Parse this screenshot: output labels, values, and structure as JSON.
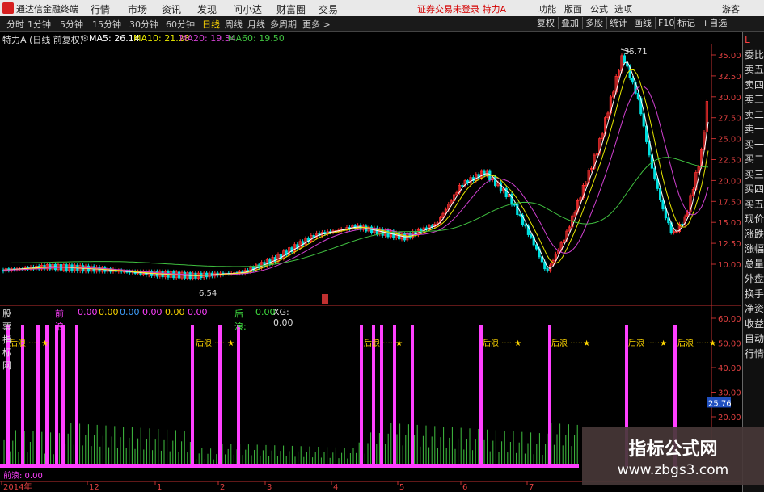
{
  "titlebar": {
    "app_title": "通达信金融终端",
    "menus": [
      "行情",
      "市场",
      "资讯",
      "发现",
      "问小达",
      "财富圈",
      "交易"
    ],
    "notice": "证券交易未登录  特力A",
    "right": [
      "功能",
      "版面",
      "公式",
      "选项"
    ],
    "user": "游客"
  },
  "toolbar": {
    "periods": [
      "分时",
      "1分钟",
      "5分钟",
      "15分钟",
      "30分钟",
      "60分钟",
      "日线",
      "周线",
      "月线",
      "多周期",
      "更多 >"
    ],
    "active": "日线",
    "right_buttons": [
      "复权",
      "叠加",
      "多股",
      "统计",
      "画线",
      "F10",
      "标记",
      "+自选"
    ]
  },
  "info": {
    "stock": "特力A (日线 前复权)",
    "ma5": "MA5: 26.14",
    "ma10": "MA10: 21.28",
    "ma20": "MA20: 19.34",
    "ma60": "MA60: 19.50"
  },
  "price_axis": [
    "35.00",
    "32.50",
    "30.00",
    "27.50",
    "25.00",
    "22.50",
    "20.00",
    "17.50",
    "15.00",
    "12.50",
    "10.00"
  ],
  "price_markers": {
    "high": "35.71",
    "low": "6.54"
  },
  "indicator": {
    "name": "股票指标网",
    "label1": "前浪",
    "values": [
      "0.00",
      "0.00",
      "0.00",
      "0.00",
      "0.00",
      "0.00"
    ],
    "label2": "后浪:",
    "v2": "0.00",
    "xg": "XG: 0.00",
    "axis": [
      "60.00",
      "50.00",
      "40.00",
      "30.00",
      "20.00"
    ],
    "current": "25.76",
    "signal_text": "后浪",
    "bottom_label": "前浪: 0.00"
  },
  "xaxis": [
    "2014年",
    "12",
    "1",
    "2",
    "3",
    "4",
    "5",
    "6",
    "7"
  ],
  "sidebar": [
    "L",
    "委比",
    "卖五",
    "卖四",
    "卖三",
    "卖二",
    "卖一",
    "买一",
    "买二",
    "买三",
    "买四",
    "买五",
    "现价",
    "涨跌",
    "涨幅",
    "总量",
    "外盘",
    "换手",
    "净资",
    "收益",
    "自动",
    "行情"
  ],
  "colors": {
    "up": "#ff3030",
    "down": "#00e0e0",
    "ma5": "#ffffff",
    "ma10": "#e8e800",
    "ma20": "#d040d0",
    "ma60": "#40c040",
    "bar": "#ff40ff"
  },
  "watermark": {
    "line1": "指标公式网",
    "line2": "www.zbgs3.com"
  }
}
